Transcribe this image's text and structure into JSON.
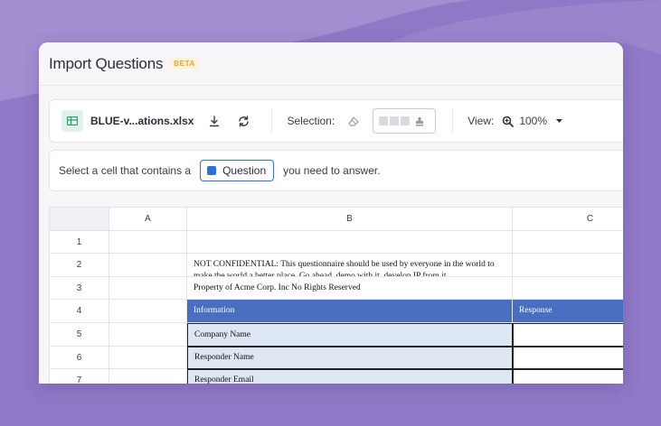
{
  "window": {
    "title": "Import Questions",
    "badge": "BETA"
  },
  "toolbar": {
    "file_name": "BLUE-v...ations.xlsx",
    "file_icon": "spreadsheet-icon",
    "download_icon": "download-icon",
    "refresh_icon": "refresh-icon",
    "selection_label": "Selection:",
    "eraser_icon": "eraser-icon",
    "view_label": "View:",
    "zoom_icon": "zoom-in-icon",
    "zoom_value": "100%",
    "dropdown_icon": "caret-down-icon"
  },
  "hint": {
    "prefix": "Select a cell that contains a",
    "pill_label": "Question",
    "suffix": "you need to answer.",
    "pill_color": "#2f6fdb"
  },
  "sheet": {
    "columns": [
      "A",
      "B",
      "C"
    ],
    "rows": [
      "1",
      "2",
      "3",
      "4",
      "5",
      "6",
      "7"
    ],
    "cells": {
      "b2": "NOT CONFIDENTIAL: This questionnaire should be used by everyone in the world to make the world a better place. Go ahead, demo with it, develop IP from it",
      "b3": "Property of Acme Corp. Inc No Rights Reserved",
      "b4": "Information",
      "c4": "Response",
      "b5": "Company Name",
      "b6": "Responder Name",
      "b7": "Responder Email"
    },
    "header_color": "#4a6fc1",
    "info_fill_color": "#dde7f3"
  },
  "colors": {
    "background": "#8f79c6",
    "accent": "#2f6fdb",
    "badge": "#e7a21f"
  }
}
